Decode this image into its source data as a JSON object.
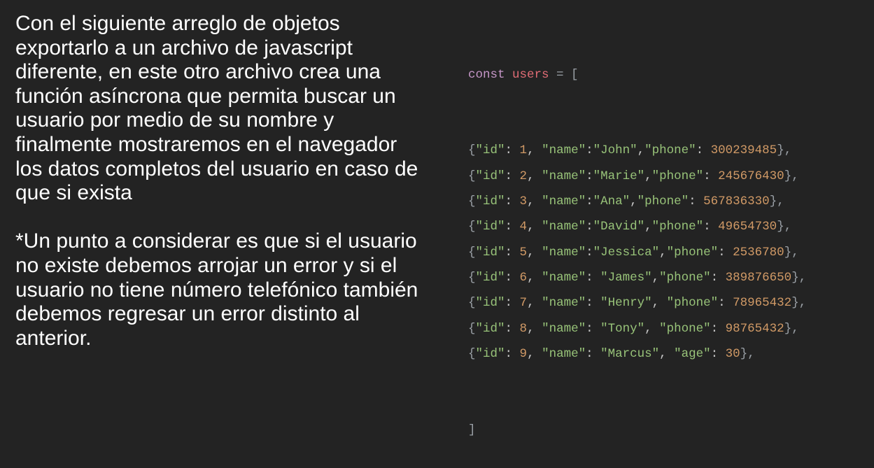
{
  "paragraph1": [
    "Con el siguiente arreglo de objetos",
    "exportarlo a un archivo de javascript",
    "diferente, en este otro archivo crea una",
    "función asíncrona que permita buscar un",
    "usuario por medio de su nombre y",
    "finalmente mostraremos en el navegador",
    "los datos completos del usuario en caso de",
    "que si exista"
  ],
  "paragraph2": [
    "*Un punto a considerar es que si el usuario",
    "no existe debemos arrojar un error y si el",
    "usuario no tiene número telefónico también",
    "debemos regresar un error distinto al",
    "anterior."
  ],
  "code": {
    "keyword": "const",
    "var_name": "users",
    "assign": " = [",
    "closing": "]",
    "rows": [
      {
        "id_key": "\"id\"",
        "id_val": "1",
        "name_key": "\"name\"",
        "name_val": "\"John\"",
        "extra_key": "\"phone\"",
        "extra_val": "300239485"
      },
      {
        "id_key": "\"id\"",
        "id_val": "2",
        "name_key": "\"name\"",
        "name_val": "\"Marie\"",
        "extra_key": "\"phone\"",
        "extra_val": "245676430"
      },
      {
        "id_key": "\"id\"",
        "id_val": "3",
        "name_key": "\"name\"",
        "name_val": "\"Ana\"",
        "extra_key": "\"phone\"",
        "extra_val": "567836330"
      },
      {
        "id_key": "\"id\"",
        "id_val": "4",
        "name_key": "\"name\"",
        "name_val": "\"David\"",
        "extra_key": "\"phone\"",
        "extra_val": "49654730"
      },
      {
        "id_key": "\"id\"",
        "id_val": "5",
        "name_key": "\"name\"",
        "name_val": "\"Jessica\"",
        "extra_key": "\"phone\"",
        "extra_val": "2536780"
      },
      {
        "id_key": "\"id\"",
        "id_val": "6",
        "name_key": "\"name\"",
        "name_val": "\"James\"",
        "extra_key": "\"phone\"",
        "extra_val": "389876650"
      },
      {
        "id_key": "\"id\"",
        "id_val": "7",
        "name_key": "\"name\"",
        "name_val": "\"Henry\"",
        "extra_key": "\"phone\"",
        "extra_val": "78965432"
      },
      {
        "id_key": "\"id\"",
        "id_val": "8",
        "name_key": "\"name\"",
        "name_val": "\"Tony\"",
        "extra_key": "\"phone\"",
        "extra_val": "98765432"
      },
      {
        "id_key": "\"id\"",
        "id_val": "9",
        "name_key": "\"name\"",
        "name_val": "\"Marcus\"",
        "extra_key": "\"age\"",
        "extra_val": "30"
      }
    ]
  },
  "colors": {
    "background": "#232323",
    "text": "#ffffff",
    "keyword": "#c596c7",
    "variable": "#e06c75",
    "string": "#98c379",
    "number": "#d19a66"
  }
}
